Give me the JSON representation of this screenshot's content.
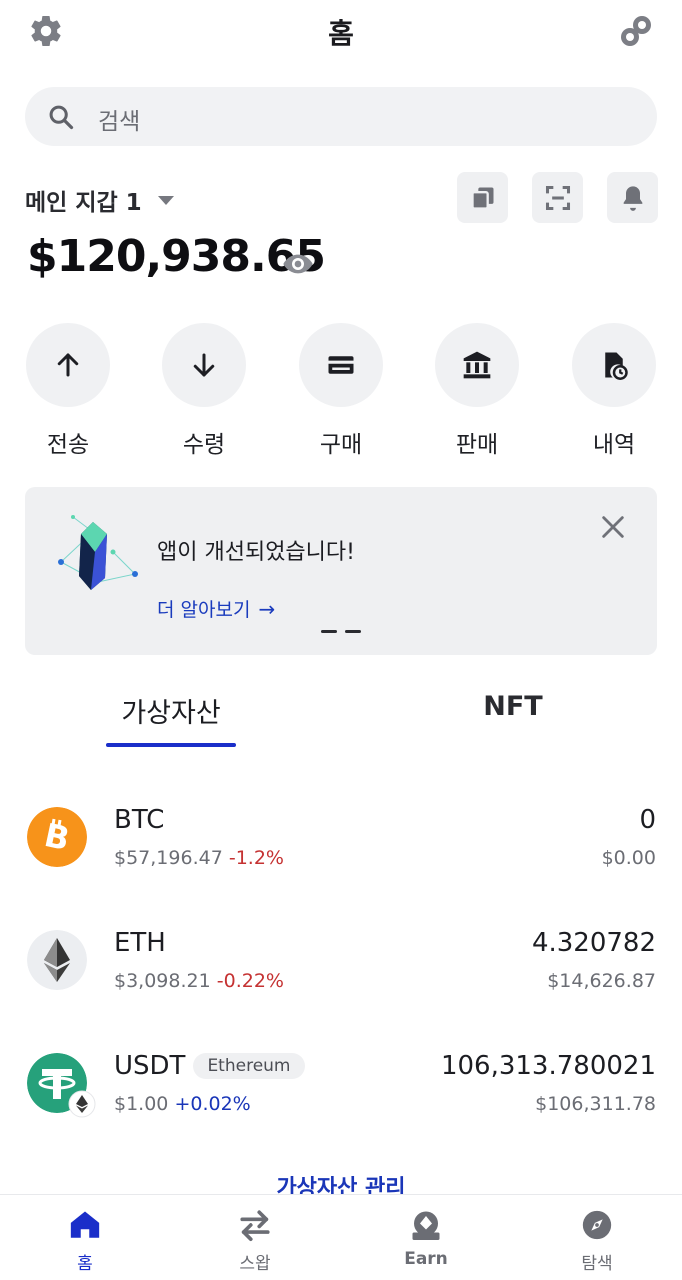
{
  "header": {
    "title": "홈",
    "settings_icon": "gear-icon",
    "connect_icon": "walletconnect-icon"
  },
  "search": {
    "placeholder": "검색",
    "icon": "search-icon"
  },
  "wallet": {
    "name": "메인 지갑 1",
    "balance": "$120,938.65",
    "tools": [
      "copy-icon",
      "scan-icon",
      "bell-icon"
    ]
  },
  "actions": [
    {
      "label": "전송",
      "icon": "arrow-up-icon"
    },
    {
      "label": "수령",
      "icon": "arrow-down-icon"
    },
    {
      "label": "구매",
      "icon": "card-icon"
    },
    {
      "label": "판매",
      "icon": "bank-icon"
    },
    {
      "label": "내역",
      "icon": "history-icon"
    }
  ],
  "banner": {
    "title": "앱이 개선되었습니다!",
    "link": "더 알아보기",
    "link_arrow": "→"
  },
  "tabs": [
    {
      "label": "가상자산",
      "active": true
    },
    {
      "label": "NFT",
      "active": false
    }
  ],
  "assets": [
    {
      "symbol": "BTC",
      "price": "$57,196.47",
      "change": "-1.2%",
      "quantity": "0",
      "value": "$0.00",
      "color": "#f7931a"
    },
    {
      "symbol": "ETH",
      "price": "$3,098.21",
      "change": "-0.22%",
      "quantity": "4.320782",
      "value": "$14,626.87",
      "color": "#eceef1"
    },
    {
      "symbol": "USDT",
      "network": "Ethereum",
      "price": "$1.00",
      "change": "+0.02%",
      "quantity": "106,313.780021",
      "value": "$106,311.78",
      "color": "#26a17b"
    }
  ],
  "manage_link": "가상자산 관리",
  "nav": [
    {
      "label": "홈",
      "icon": "home-icon",
      "active": true
    },
    {
      "label": "스왑",
      "icon": "swap-icon",
      "active": false
    },
    {
      "label": "Earn",
      "icon": "earn-icon",
      "active": false
    },
    {
      "label": "탐색",
      "icon": "compass-icon",
      "active": false
    }
  ],
  "colors": {
    "accent": "#1a2ec9",
    "negative": "#c53232",
    "positive": "#1a36b8"
  }
}
